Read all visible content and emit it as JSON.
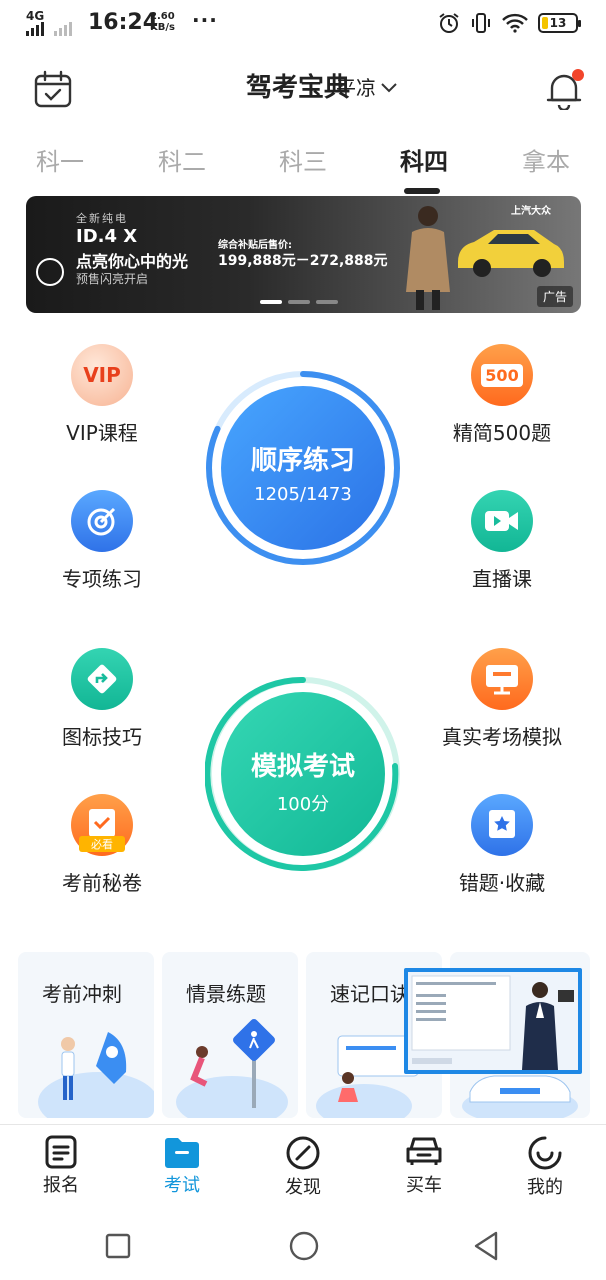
{
  "status_bar": {
    "network": "4G",
    "time": "16:24",
    "speed_value": "2.60",
    "speed_unit": "KB/s",
    "more": "···",
    "battery": "13"
  },
  "header": {
    "title": "驾考宝典",
    "city": "平凉"
  },
  "tabs": [
    {
      "label": "科一"
    },
    {
      "label": "科二"
    },
    {
      "label": "科三"
    },
    {
      "label": "科四"
    },
    {
      "label": "拿本"
    }
  ],
  "banner": {
    "tagline": "全新纯电",
    "model": "ID.4 X",
    "slogan": "点亮你心中的光",
    "presale": "预售闪亮开启",
    "subsidy_label": "综合补贴后售价:",
    "price": "199,888元－272,888元",
    "brand": "上汽大众",
    "ad_label": "广告"
  },
  "features": {
    "vip": "VIP课程",
    "jingjian": "精简500题",
    "zhuanxiang": "专项练习",
    "zhibo": "直播课",
    "tubiao": "图标技巧",
    "zhenshi": "真实考场模拟",
    "kaoqian": "考前秘卷",
    "cuoti": "错题·收藏",
    "vip_badge": "VIP",
    "jingjian_badge": "500",
    "kaoqian_badge": "必看"
  },
  "sequential": {
    "title": "顺序练习",
    "progress_text": "1205/1473",
    "done": 1205,
    "total": 1473
  },
  "mock_exam": {
    "title": "模拟考试",
    "score": "100分"
  },
  "cards": [
    {
      "title": "考前冲刺"
    },
    {
      "title": "情景练题"
    },
    {
      "title": "速记口诀"
    }
  ],
  "bottom_nav": [
    {
      "label": "报名"
    },
    {
      "label": "考试"
    },
    {
      "label": "发现"
    },
    {
      "label": "买车"
    },
    {
      "label": "我的"
    }
  ],
  "colors": {
    "blue": "#2f8cf0",
    "green": "#1ec7a5",
    "orange": "#ff7a2e",
    "nav_active": "#1296db"
  }
}
